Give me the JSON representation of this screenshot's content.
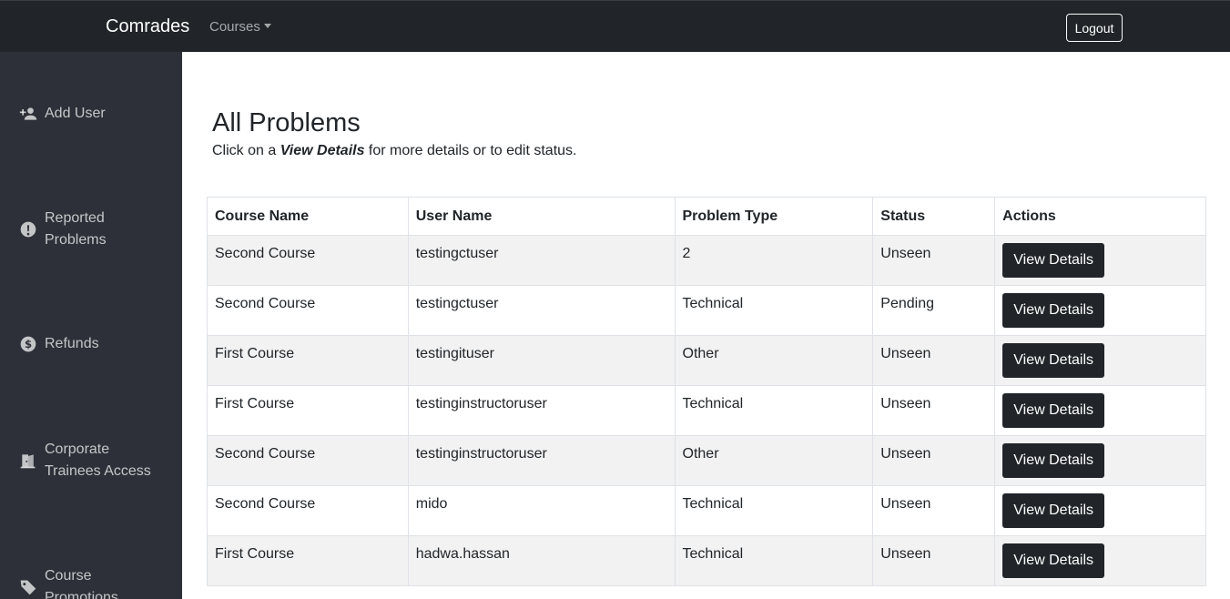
{
  "navbar": {
    "brand": "Comrades",
    "courses_label": "Courses",
    "logout_label": "Logout"
  },
  "sidebar": {
    "items": [
      {
        "label": "Add User",
        "icon": "add-user-icon"
      },
      {
        "label": "Reported Problems",
        "icon": "alert-circle-icon"
      },
      {
        "label": "Refunds",
        "icon": "dollar-circle-icon"
      },
      {
        "label": "Corporate Trainees Access",
        "icon": "door-open-icon"
      },
      {
        "label": "Course Promotions",
        "icon": "tag-icon"
      }
    ]
  },
  "main": {
    "title": "All Problems",
    "subtitle_prefix": "Click on a ",
    "subtitle_emphasis": "View Details",
    "subtitle_suffix": " for more details or to edit status."
  },
  "table": {
    "headers": [
      "Course Name",
      "User Name",
      "Problem Type",
      "Status",
      "Actions"
    ],
    "action_label": "View Details",
    "rows": [
      {
        "course": "Second Course",
        "user": "testingctuser",
        "type": "2",
        "status": "Unseen"
      },
      {
        "course": "Second Course",
        "user": "testingctuser",
        "type": "Technical",
        "status": "Pending"
      },
      {
        "course": "First Course",
        "user": "testingituser",
        "type": "Other",
        "status": "Unseen"
      },
      {
        "course": "First Course",
        "user": "testinginstructoruser",
        "type": "Technical",
        "status": "Unseen"
      },
      {
        "course": "Second Course",
        "user": "testinginstructoruser",
        "type": "Other",
        "status": "Unseen"
      },
      {
        "course": "Second Course",
        "user": "mido",
        "type": "Technical",
        "status": "Unseen"
      },
      {
        "course": "First Course",
        "user": "hadwa.hassan",
        "type": "Technical",
        "status": "Unseen"
      }
    ]
  },
  "colors": {
    "navbar": "#212529",
    "sidebar": "#2d3038",
    "button": "#212529",
    "stripe": "#f2f2f2"
  }
}
